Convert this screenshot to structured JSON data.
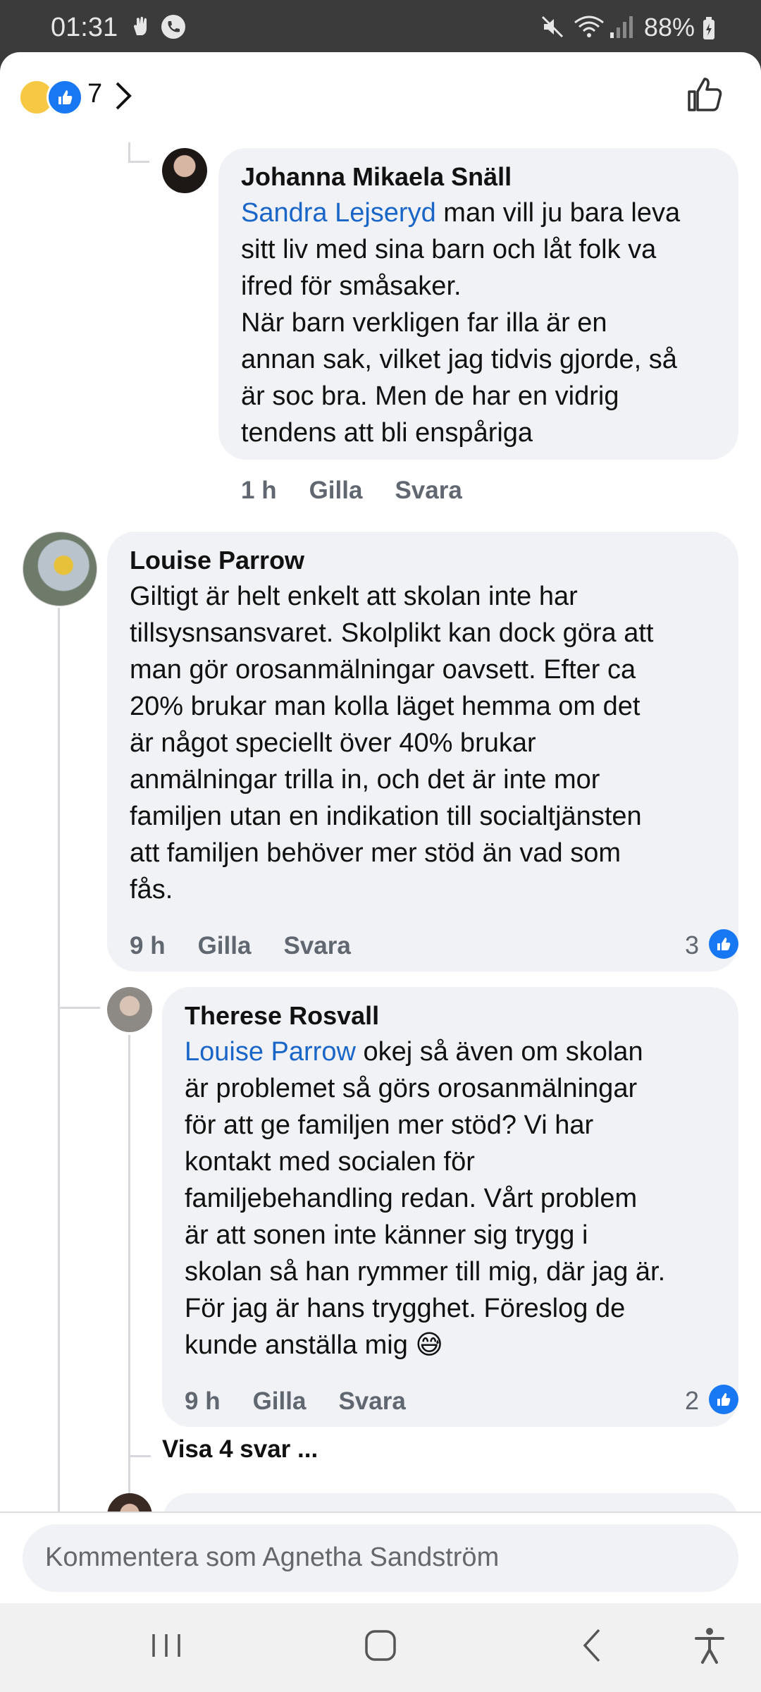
{
  "status": {
    "time": "01:31",
    "battery": "88%"
  },
  "header": {
    "reaction_count": "7"
  },
  "comments": [
    {
      "author": "Johanna Mikaela Snäll",
      "mention": "Sandra Lejseryd",
      "lines": [
        " man vill ju bara leva",
        "sitt liv med sina barn och låt folk va",
        "ifred för småsaker.",
        "När barn verkligen far illa är en",
        "annan sak, vilket jag tidvis gjorde, så",
        "är soc bra. Men de har en vidrig",
        "tendens att bli enspåriga"
      ],
      "time": "1 h",
      "like": "Gilla",
      "reply": "Svara"
    },
    {
      "author": "Louise Parrow",
      "lines": [
        "Giltigt är helt enkelt att skolan inte har",
        "tillsysnsansvaret. Skolplikt kan dock göra att",
        "man gör orosanmälningar oavsett. Efter ca",
        "20% brukar man kolla läget hemma om det",
        "är något speciellt över 40% brukar",
        "anmälningar trilla in, och det är inte mor",
        "familjen utan en indikation till socialtjänsten",
        "att familjen behöver mer stöd än vad som",
        "fås."
      ],
      "time": "9 h",
      "like": "Gilla",
      "reply": "Svara",
      "likes": "3"
    },
    {
      "author": "Therese Rosvall",
      "mention": "Louise Parrow",
      "lines": [
        " okej så även om skolan",
        "är problemet så görs orosanmälningar",
        "för att ge familjen mer stöd? Vi har",
        "kontakt med socialen för",
        "familjebehandling redan. Vårt problem",
        "är att sonen inte känner sig trygg i",
        "skolan så han rymmer till mig, där jag är.",
        "För jag är hans trygghet. Föreslog de",
        "kunde anställa mig 😅"
      ],
      "time": "9 h",
      "like": "Gilla",
      "reply": "Svara",
      "likes": "2"
    }
  ],
  "view_replies": "Visa 4 svar ...",
  "composer": {
    "placeholder": "Kommentera som Agnetha Sandström"
  },
  "icons": [
    "mute-icon",
    "wifi-icon",
    "signal-icon",
    "battery-icon",
    "like-outline-icon",
    "chevron-right-icon",
    "recent-apps-icon",
    "home-icon",
    "back-icon",
    "accessibility-icon"
  ],
  "colors": {
    "mention": "#1a66c8",
    "like_blue": "#1877f2",
    "bubble": "#f0f2f5"
  }
}
